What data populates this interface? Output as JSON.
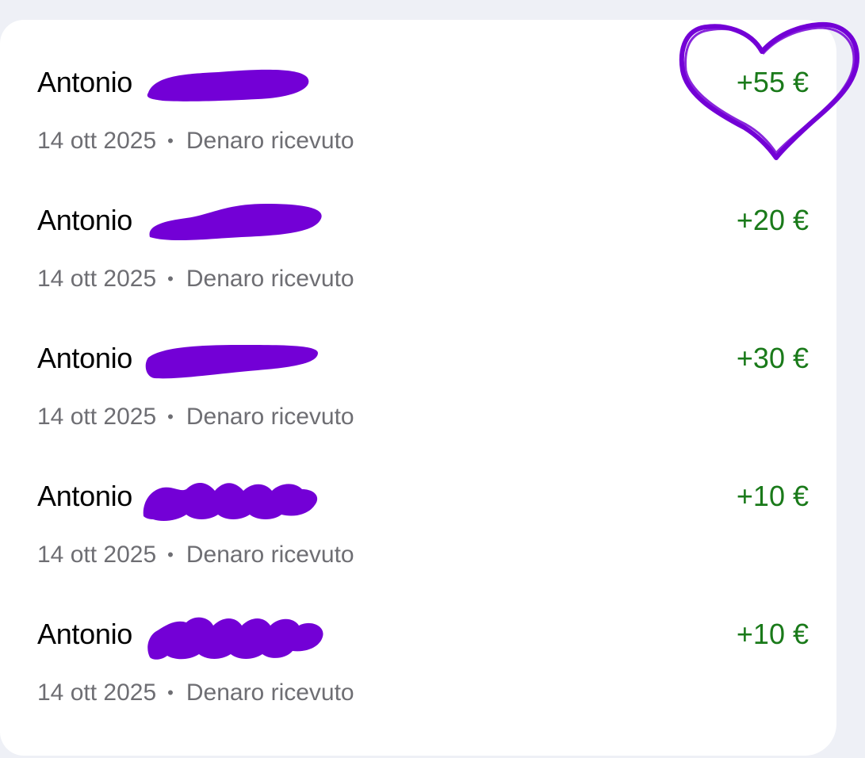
{
  "transactions": [
    {
      "name": "Antonio",
      "date": "14 ott 2025",
      "separator": "•",
      "type": "Denaro ricevuto",
      "amount": "+55 €"
    },
    {
      "name": "Antonio",
      "date": "14 ott 2025",
      "separator": "•",
      "type": "Denaro ricevuto",
      "amount": "+20 €"
    },
    {
      "name": "Antonio",
      "date": "14 ott 2025",
      "separator": "•",
      "type": "Denaro ricevuto",
      "amount": "+30 €"
    },
    {
      "name": "Antonio",
      "date": "14 ott 2025",
      "separator": "•",
      "type": "Denaro ricevuto",
      "amount": "+10 €"
    },
    {
      "name": "Antonio",
      "date": "14 ott 2025",
      "separator": "•",
      "type": "Denaro ricevuto",
      "amount": "+10 €"
    }
  ],
  "colors": {
    "amount_positive": "#1a7a1a",
    "meta_text": "#6e6e73",
    "redaction_scribble": "#7300d6",
    "heart_drawing": "#7300d6"
  },
  "annotations": {
    "heart_icon": "heart-doodle-icon",
    "redaction_icon": "redaction-scribble-icon"
  }
}
